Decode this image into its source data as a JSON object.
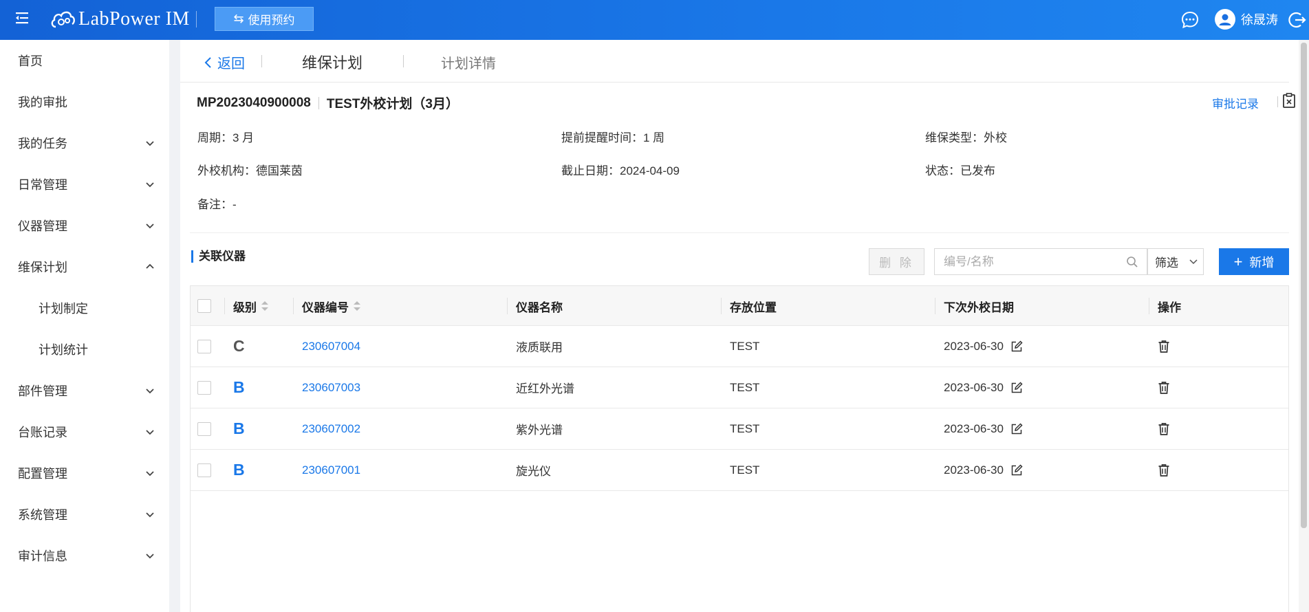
{
  "topbar": {
    "brand": "LabPower IM",
    "use_booking_label": "使用预约",
    "user_name": "徐晟涛",
    "colors": {
      "bar_start": "#1362d6",
      "bar_end": "#1f86f0",
      "booking_btn": "#4b9bf5"
    }
  },
  "sidebar": {
    "items": [
      {
        "label": "首页"
      },
      {
        "label": "我的审批"
      },
      {
        "label": "我的任务"
      },
      {
        "label": "日常管理"
      },
      {
        "label": "仪器管理"
      },
      {
        "label": "维保计划"
      },
      {
        "label": "计划制定"
      },
      {
        "label": "计划统计"
      },
      {
        "label": "部件管理"
      },
      {
        "label": "台账记录"
      },
      {
        "label": "配置管理"
      },
      {
        "label": "系统管理"
      },
      {
        "label": "审计信息"
      }
    ]
  },
  "header": {
    "back_label": "返回",
    "tab_active": "维保计划",
    "tab_inactive": "计划详情"
  },
  "plan": {
    "code": "MP2023040900008",
    "name": "TEST外校计划（3月）",
    "approval_link": "审批记录",
    "fields": {
      "period": "周期：3 月",
      "reminder": "提前提醒时间：1 周",
      "maint_type": "维保类型：外校",
      "org": "外校机构：德国莱茵",
      "deadline": "截止日期：2024-04-09",
      "status": "状态：已发布",
      "remark": "备注：-"
    }
  },
  "instruments": {
    "section_title": "关联仪器",
    "delete_label": "删 除",
    "search_placeholder": "编号/名称",
    "filter_label": "筛选",
    "add_label": "新增",
    "columns": [
      "级别",
      "仪器编号",
      "仪器名称",
      "存放位置",
      "下次外校日期",
      "操作"
    ],
    "rows": [
      {
        "level": "C",
        "code": "230607004",
        "name": "液质联用",
        "location": "TEST",
        "next_date": "2023-06-30"
      },
      {
        "level": "B",
        "code": "230607003",
        "name": "近红外光谱",
        "location": "TEST",
        "next_date": "2023-06-30"
      },
      {
        "level": "B",
        "code": "230607002",
        "name": "紫外光谱",
        "location": "TEST",
        "next_date": "2023-06-30"
      },
      {
        "level": "B",
        "code": "230607001",
        "name": "旋光仪",
        "location": "TEST",
        "next_date": "2023-06-30"
      }
    ],
    "level_colors": {
      "C": "#555555",
      "B": "#1a78e8"
    }
  }
}
